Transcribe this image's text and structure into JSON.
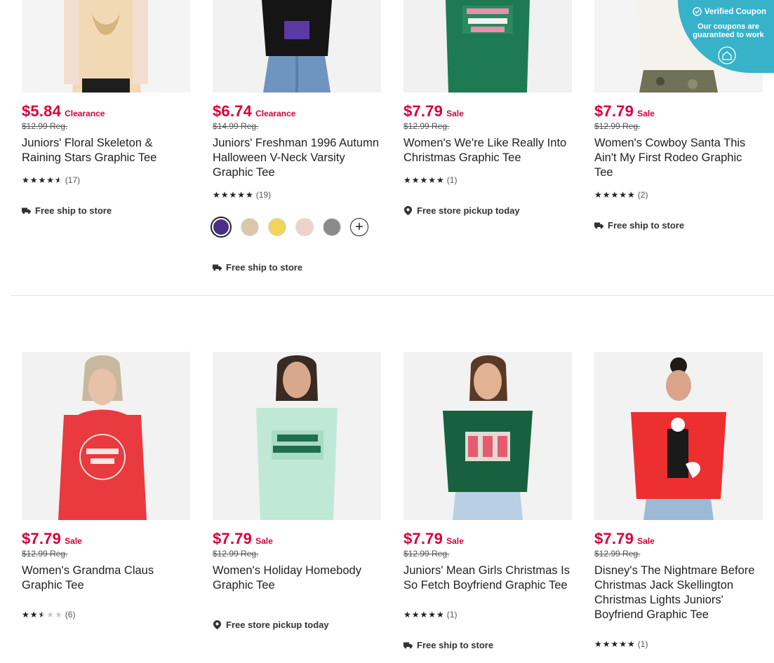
{
  "products": [
    {
      "name": "floral-skeleton",
      "price": "$5.84",
      "price_type": "Clearance",
      "reg_price": "$12.99 Reg.",
      "title": "Juniors' Floral Skeleton & Raining Stars Graphic Tee",
      "rating": 4.5,
      "review_count": "(17)",
      "fulfillment": "Free ship to store",
      "fulfillment_icon": "truck-icon"
    },
    {
      "name": "freshman-1996",
      "price": "$6.74",
      "price_type": "Clearance",
      "reg_price": "$14.99 Reg.",
      "title": "Juniors' Freshman 1996 Autumn Halloween V-Neck Varsity Graphic Tee",
      "rating": 5,
      "review_count": "(19)",
      "swatches": [
        "#4a2f86",
        "#d8c7a8",
        "#f0d45b",
        "#eed3c8",
        "#8a8a8a"
      ],
      "fulfillment": "Free ship to store",
      "fulfillment_icon": "truck-icon"
    },
    {
      "name": "really-into-christmas",
      "price": "$7.79",
      "price_type": "Sale",
      "reg_price": "$12.99 Reg.",
      "title": "Women's We're Like Really Into Christmas Graphic Tee",
      "rating": 5,
      "review_count": "(1)",
      "fulfillment": "Free store pickup today",
      "fulfillment_icon": "pin-icon"
    },
    {
      "name": "cowboy-santa",
      "price": "$7.79",
      "price_type": "Sale",
      "reg_price": "$12.99 Reg.",
      "title": "Women's Cowboy Santa This Ain't My First Rodeo Graphic Tee",
      "rating": 5,
      "review_count": "(2)",
      "fulfillment": "Free ship to store",
      "fulfillment_icon": "truck-icon"
    },
    {
      "name": "grandma-claus",
      "price": "$7.79",
      "price_type": "Sale",
      "reg_price": "$12.99 Reg.",
      "title": "Women's Grandma Claus Graphic Tee",
      "rating": 2.5,
      "review_count": "(6)",
      "fulfillment": "",
      "fulfillment_icon": ""
    },
    {
      "name": "holiday-homebody",
      "price": "$7.79",
      "price_type": "Sale",
      "reg_price": "$12.99 Reg.",
      "title": "Women's Holiday Homebody Graphic Tee",
      "rating": null,
      "review_count": "",
      "fulfillment": "Free store pickup today",
      "fulfillment_icon": "pin-icon"
    },
    {
      "name": "mean-girls",
      "price": "$7.79",
      "price_type": "Sale",
      "reg_price": "$12.99 Reg.",
      "title": "Juniors' Mean Girls Christmas Is So Fetch Boyfriend Graphic Tee",
      "rating": 5,
      "review_count": "(1)",
      "fulfillment": "Free ship to store",
      "fulfillment_icon": "truck-icon"
    },
    {
      "name": "jack-skellington",
      "price": "$7.79",
      "price_type": "Sale",
      "reg_price": "$12.99 Reg.",
      "title": "Disney's The Nightmare Before Christmas Jack Skellington Christmas Lights Juniors' Boyfriend Graphic Tee",
      "rating": 5,
      "review_count": "(1)",
      "fulfillment": "",
      "fulfillment_icon": ""
    }
  ],
  "coupon_badge": {
    "title": "Verified Coupon",
    "subtitle": "Our coupons are guaranteed to work",
    "icon": "check-circle-icon"
  },
  "colors": {
    "sale_red": "#d7003a",
    "coupon_teal": "#37b2c9"
  }
}
